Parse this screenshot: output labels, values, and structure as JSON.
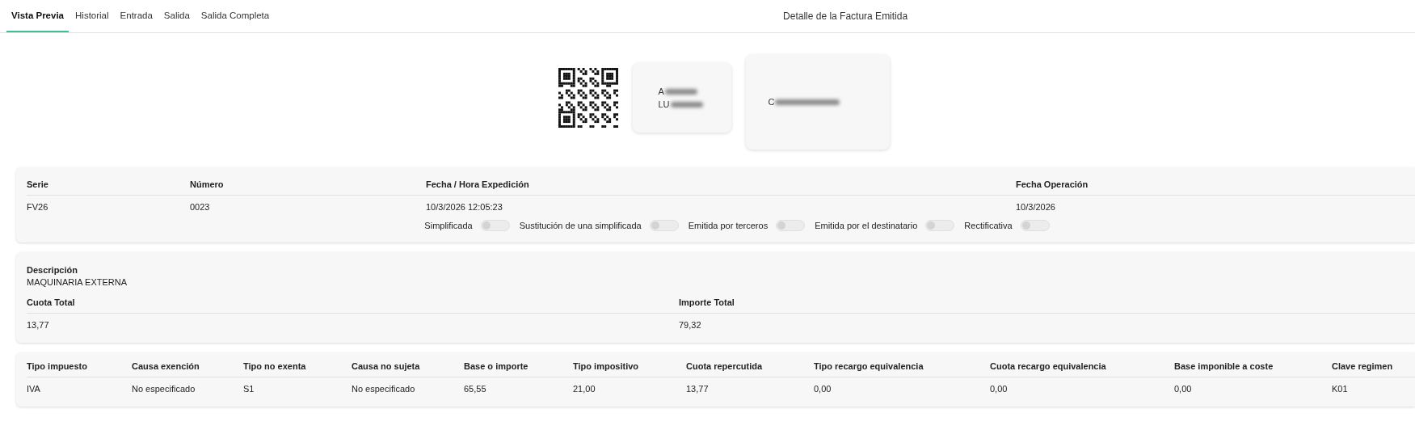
{
  "tabs": [
    {
      "label": "Vista Previa",
      "selected": true
    },
    {
      "label": "Historial",
      "selected": false
    },
    {
      "label": "Entrada",
      "selected": false
    },
    {
      "label": "Salida",
      "selected": false
    },
    {
      "label": "Salida Completa",
      "selected": false
    }
  ],
  "title": "Detalle de la Factura Emitida",
  "header_cards": [
    {
      "lines": [
        "A",
        "LU"
      ]
    },
    {
      "lines": [
        "C"
      ]
    }
  ],
  "invoice": {
    "columns": [
      "Serie",
      "Número",
      "Fecha / Hora Expedición",
      "Fecha Operación"
    ],
    "values": [
      "FV26",
      "0023",
      "10/3/2026 12:05:23",
      "10/3/2026"
    ],
    "flags": [
      {
        "label": "Simplificada",
        "on": false
      },
      {
        "label": "Sustitución de una simplificada",
        "on": false
      },
      {
        "label": "Emitida por terceros",
        "on": false
      },
      {
        "label": "Emitida por el destinatario",
        "on": false
      },
      {
        "label": "Rectificativa",
        "on": false
      }
    ]
  },
  "summary": {
    "description_label": "Descripción",
    "description": "MAQUINARIA EXTERNA",
    "columns": [
      "Cuota Total",
      "Importe Total"
    ],
    "values": [
      "13,77",
      "79,32"
    ]
  },
  "breakdown": {
    "columns": [
      "Tipo impuesto",
      "Causa exención",
      "Tipo no exenta",
      "Causa no sujeta",
      "Base o importe",
      "Tipo impositivo",
      "Cuota repercutida",
      "Tipo recargo equivalencia",
      "Cuota recargo equivalencia",
      "Base imponible a coste",
      "Clave regimen"
    ],
    "rows": [
      [
        "IVA",
        "No especificado",
        "S1",
        "No especificado",
        "65,55",
        "21,00",
        "13,77",
        "0,00",
        "0,00",
        "0,00",
        "K01"
      ]
    ]
  }
}
